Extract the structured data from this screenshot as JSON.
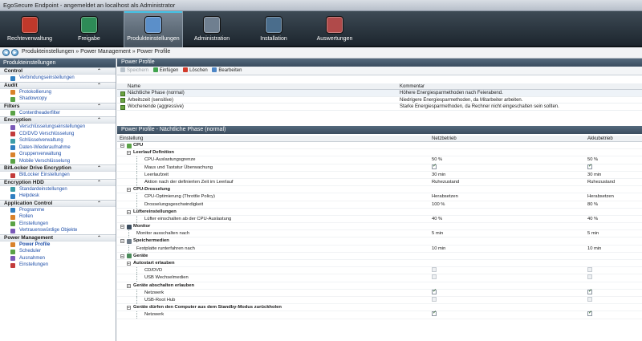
{
  "window": {
    "title": "EgoSecure Endpoint - angemeldet an localhost als Administrator"
  },
  "toolbar": [
    {
      "label": "Rechteverwaltung",
      "icon": "rights-management-icon",
      "color": "#c0392b"
    },
    {
      "label": "Freigabe",
      "icon": "release-icon",
      "color": "#2e8b57"
    },
    {
      "label": "Produkteinstellungen",
      "icon": "product-settings-icon",
      "color": "#5b8fc9",
      "active": true
    },
    {
      "label": "Administration",
      "icon": "administration-icon",
      "color": "#6f7f90"
    },
    {
      "label": "Installation",
      "icon": "installation-icon",
      "color": "#4a6d8c"
    },
    {
      "label": "Auswertungen",
      "icon": "reports-icon",
      "color": "#b04a4a"
    }
  ],
  "breadcrumb": "Produkteinstellungen » Power Management » Power Profile",
  "sidebar": {
    "title": "Produkteinstellungen",
    "groups": [
      {
        "name": "Control",
        "items": [
          "Verbindungseinstellungen"
        ]
      },
      {
        "name": "Audit",
        "items": [
          "Protokollierung",
          "Shadowcopy"
        ]
      },
      {
        "name": "Filters",
        "items": [
          "Contentheaderfilter"
        ]
      },
      {
        "name": "Encryption",
        "items": [
          "Verschlüsselungseinstellungen",
          "CD/DVD Verschlüsselung",
          "Schlüsselverwaltung",
          "Daten-Wiederaufnahme",
          "Gruppenverwaltung",
          "Mobile Verschlüsselung"
        ]
      },
      {
        "name": "BitLocker Drive Encryption",
        "items": [
          "BitLocker Einstellungen"
        ]
      },
      {
        "name": "Encryption HDD",
        "items": [
          "Standardeinstellungen",
          "Helpdesk"
        ]
      },
      {
        "name": "Application Control",
        "items": [
          "Programme",
          "Rollen",
          "Einstellungen",
          "Vertrauenswürdige Objekte"
        ]
      },
      {
        "name": "Power Management",
        "items": [
          "Power Profile",
          "Scheduler",
          "Ausnahmen",
          "Einstellungen"
        ]
      }
    ],
    "selected": "Power Profile"
  },
  "profile_panel": {
    "title": "Power Profile",
    "toolbar": {
      "save": "Speichern",
      "add": "Einfügen",
      "delete": "Löschen",
      "edit": "Bearbeiten"
    },
    "columns": {
      "name": "Name",
      "comment": "Kommentar"
    },
    "rows": [
      {
        "name": "Nächtliche Phase (normal)",
        "comment": "Höhere Energiesparmethoden nach Feierabend."
      },
      {
        "name": "Arbeitszeit (sensitive)",
        "comment": "Niedrigere Energiesparmethoden, da Mitarbeiter arbeiten."
      },
      {
        "name": "Wochenende (aggressive)",
        "comment": "Starke Energiesparmethoden, da Rechner nicht eingeschalten sein sollten."
      }
    ]
  },
  "detail_panel": {
    "title": "Power Profile - Nächtliche Phase (normal)",
    "columns": {
      "setting": "Einstellung",
      "ac": "Netzbetrieb",
      "dc": "Akkubetrieb"
    },
    "rows": [
      {
        "level": 0,
        "name": "CPU",
        "cat": true,
        "icon": "cpu-icon"
      },
      {
        "level": 1,
        "name": "Leerlauf Definition",
        "cat": true
      },
      {
        "level": 2,
        "name": "CPU-Auslastungsgrenze",
        "ac": "50 %",
        "dc": "50 %"
      },
      {
        "level": 2,
        "name": "Maus und Tastatur Überwachung",
        "ac_cb": "on",
        "dc_cb": "on"
      },
      {
        "level": 2,
        "name": "Leerlaufzeit",
        "ac": "30 min",
        "dc": "30 min"
      },
      {
        "level": 2,
        "name": "Aktion nach der definierten Zeit im Leerlauf",
        "ac": "Ruhezustand",
        "dc": "Ruhezustand"
      },
      {
        "level": 1,
        "name": "CPU-Drosselung",
        "cat": true
      },
      {
        "level": 2,
        "name": "CPU-Optimierung (Throttle Policy)",
        "ac": "Herabsetzen",
        "dc": "Herabsetzen"
      },
      {
        "level": 2,
        "name": "Drosselungsgeschwindigkeit",
        "ac": "100 %",
        "dc": "80 %"
      },
      {
        "level": 1,
        "name": "Lüftereinstellungen",
        "cat": true
      },
      {
        "level": 2,
        "name": "Lüfter einschalten ab der CPU-Auslastung",
        "ac": "40 %",
        "dc": "40 %"
      },
      {
        "level": 0,
        "name": "Monitor",
        "cat": true,
        "icon": "monitor-icon"
      },
      {
        "level": 1,
        "name": "Monitor ausschalten nach",
        "ac": "5 min",
        "dc": "5 min"
      },
      {
        "level": 0,
        "name": "Speichermedien",
        "cat": true,
        "icon": "storage-icon"
      },
      {
        "level": 1,
        "name": "Festplatte runterfahren nach",
        "ac": "10 min",
        "dc": "10 min"
      },
      {
        "level": 0,
        "name": "Geräte",
        "cat": true,
        "icon": "devices-icon"
      },
      {
        "level": 1,
        "name": "Autostart erlauben",
        "cat": true
      },
      {
        "level": 2,
        "name": "CD/DVD",
        "ac_cb": "dis",
        "dc_cb": "dis"
      },
      {
        "level": 2,
        "name": "USB Wechselmedien",
        "ac_cb": "dis",
        "dc_cb": "dis"
      },
      {
        "level": 1,
        "name": "Geräte abschalten erlauben",
        "cat": true
      },
      {
        "level": 2,
        "name": "Netzwerk",
        "ac_cb": "on",
        "dc_cb": "on"
      },
      {
        "level": 2,
        "name": "USB-Root Hub",
        "ac_cb": "dis",
        "dc_cb": "dis"
      },
      {
        "level": 1,
        "name": "Geräte dürfen den Computer aus dem Standby-Modus zurückholen",
        "cat": true
      },
      {
        "level": 2,
        "name": "Netzwerk",
        "ac_cb": "on",
        "dc_cb": "on"
      }
    ]
  }
}
